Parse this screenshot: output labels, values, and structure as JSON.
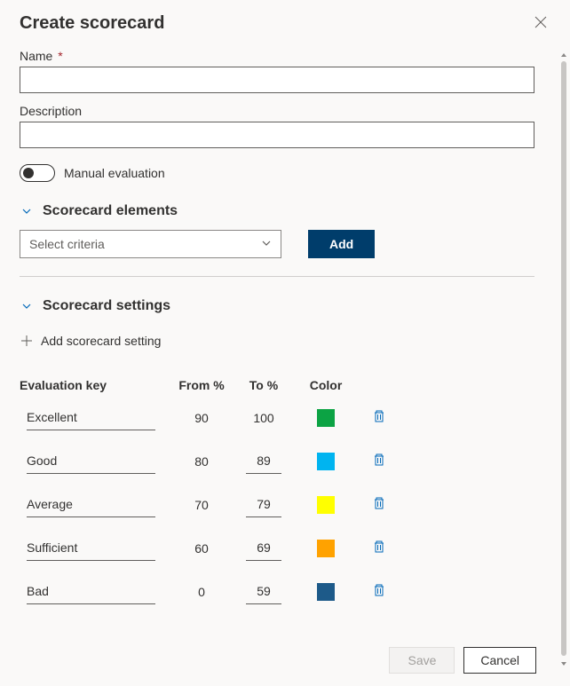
{
  "header": {
    "title": "Create scorecard"
  },
  "form": {
    "name_label": "Name",
    "required_mark": "*",
    "description_label": "Description",
    "manual_eval_label": "Manual evaluation"
  },
  "sections": {
    "elements_title": "Scorecard elements",
    "settings_title": "Scorecard settings",
    "add_setting_label": "Add scorecard setting",
    "criteria_placeholder": "Select criteria",
    "add_label": "Add"
  },
  "table": {
    "headers": {
      "key": "Evaluation key",
      "from": "From %",
      "to": "To %",
      "color": "Color"
    },
    "rows": [
      {
        "key": "Excellent",
        "from": "90",
        "to": "100",
        "to_editable": false,
        "color": "#0ca344"
      },
      {
        "key": "Good",
        "from": "80",
        "to": "89",
        "to_editable": true,
        "color": "#00b4f0"
      },
      {
        "key": "Average",
        "from": "70",
        "to": "79",
        "to_editable": true,
        "color": "#ffff00"
      },
      {
        "key": "Sufficient",
        "from": "60",
        "to": "69",
        "to_editable": true,
        "color": "#ffa200"
      },
      {
        "key": "Bad",
        "from": "0",
        "to": "59",
        "to_editable": true,
        "color": "#1d5a89"
      }
    ]
  },
  "footer": {
    "save": "Save",
    "cancel": "Cancel"
  }
}
